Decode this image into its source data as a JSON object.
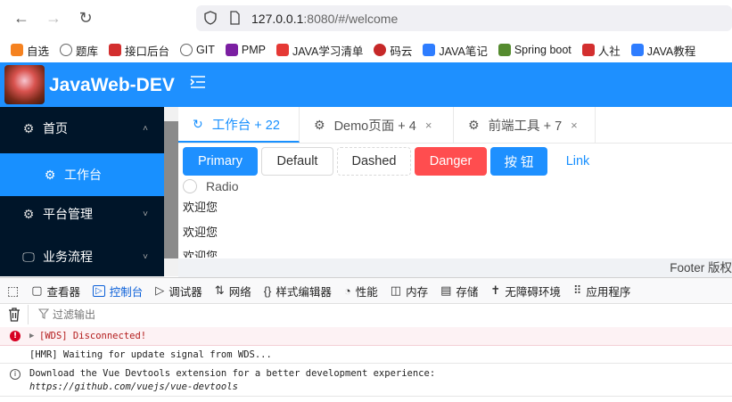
{
  "browser": {
    "url_host": "127.0.0.1",
    "url_rest": ":8080/#/welcome",
    "bookmarks": [
      {
        "label": "自选",
        "color": "#f58220"
      },
      {
        "label": "题库",
        "color": "#666666"
      },
      {
        "label": "接口后台",
        "color": "#d32f2f"
      },
      {
        "label": "GIT",
        "color": "#666666"
      },
      {
        "label": "PMP",
        "color": "#7b1fa2"
      },
      {
        "label": "JAVA学习清单",
        "color": "#e53935"
      },
      {
        "label": "码云",
        "color": "#c62828"
      },
      {
        "label": "JAVA笔记",
        "color": "#2e7dff"
      },
      {
        "label": "Spring boot",
        "color": "#558b2f"
      },
      {
        "label": "人社",
        "color": "#d32f2f"
      },
      {
        "label": "JAVA教程",
        "color": "#2e7dff"
      }
    ]
  },
  "app": {
    "brand": "JavaWeb-DEV",
    "sidebar": {
      "items": [
        {
          "label": "首页",
          "icon": "gear-icon",
          "arrow": "˄"
        },
        {
          "label": "工作台",
          "icon": "gear-icon",
          "arrow": ""
        },
        {
          "label": "平台管理",
          "icon": "gear-icon",
          "arrow": "˅"
        },
        {
          "label": "业务流程",
          "icon": "monitor-icon",
          "arrow": "˅"
        }
      ]
    },
    "tabs": [
      {
        "label": "工作台 + 22",
        "icon": "refresh-icon",
        "closable": false
      },
      {
        "label": "Demo页面 + 4",
        "icon": "gear-icon",
        "closable": true
      },
      {
        "label": "前端工具 + 7",
        "icon": "gear-icon",
        "closable": true
      }
    ],
    "close_glyph": "×",
    "buttons": {
      "primary": "Primary",
      "default": "Default",
      "dashed": "Dashed",
      "danger": "Danger",
      "button": "按 钮",
      "link": "Link"
    },
    "radio_label": "Radio",
    "welcome_lines": [
      "欢迎您",
      "欢迎您",
      "欢迎您"
    ],
    "footer": "Footer 版权"
  },
  "devtools": {
    "tabs": [
      {
        "label": "查看器",
        "icon": "▢"
      },
      {
        "label": "控制台",
        "icon": "▷"
      },
      {
        "label": "调试器",
        "icon": "▷"
      },
      {
        "label": "网络",
        "icon": "⇅"
      },
      {
        "label": "样式编辑器",
        "icon": "{}"
      },
      {
        "label": "性能",
        "icon": "◔"
      },
      {
        "label": "内存",
        "icon": "◫"
      },
      {
        "label": "存储",
        "icon": "▤"
      },
      {
        "label": "无障碍环境",
        "icon": "✝"
      },
      {
        "label": "应用程序",
        "icon": "⠿"
      }
    ],
    "active_tab": 1,
    "filter_placeholder": "过滤输出",
    "logs": {
      "error": "[WDS] Disconnected!",
      "hmr": "[HMR] Waiting for update signal from WDS...",
      "info_line1": "Download the Vue Devtools extension for a better development experience:",
      "info_line2": "https://github.com/vuejs/vue-devtools"
    }
  },
  "colors": {
    "primary": "#1e90ff",
    "danger": "#ff4d4f",
    "sidebar_bg": "#001529",
    "active_blue": "#1890ff"
  }
}
